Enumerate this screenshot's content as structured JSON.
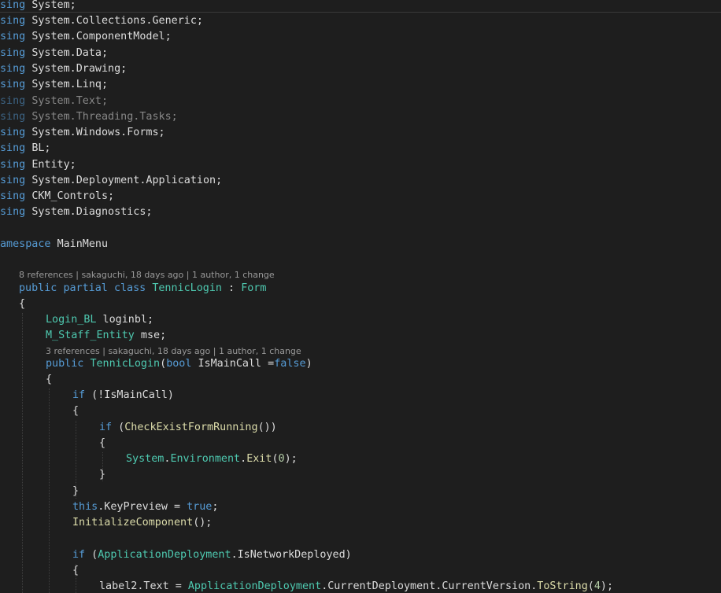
{
  "editor": {
    "usings": [
      {
        "kw": "sing",
        "ns": "System;",
        "dim": false
      },
      {
        "kw": "sing",
        "ns": "System.Collections.Generic;",
        "dim": false
      },
      {
        "kw": "sing",
        "ns": "System.ComponentModel;",
        "dim": false
      },
      {
        "kw": "sing",
        "ns": "System.Data;",
        "dim": false
      },
      {
        "kw": "sing",
        "ns": "System.Drawing;",
        "dim": false
      },
      {
        "kw": "sing",
        "ns": "System.Linq;",
        "dim": false
      },
      {
        "kw": "sing",
        "ns": "System.Text;",
        "dim": true
      },
      {
        "kw": "sing",
        "ns": "System.Threading.Tasks;",
        "dim": true
      },
      {
        "kw": "sing",
        "ns": "System.Windows.Forms;",
        "dim": false
      },
      {
        "kw": "sing",
        "ns": "BL;",
        "dim": false
      },
      {
        "kw": "sing",
        "ns": "Entity;",
        "dim": false
      },
      {
        "kw": "sing",
        "ns": "System.Deployment.Application;",
        "dim": false
      },
      {
        "kw": "sing",
        "ns": "CKM_Controls;",
        "dim": false
      },
      {
        "kw": "sing",
        "ns": "System.Diagnostics;",
        "dim": false
      }
    ],
    "namespace_kw": "amespace",
    "namespace_name": "MainMenu",
    "class_lens": "8 references | sakaguchi, 18 days ago | 1 author, 1 change",
    "ctor_lens": "3 references | sakaguchi, 18 days ago | 1 author, 1 change",
    "code": [
      [
        [
          "kw",
          "public"
        ],
        [
          "pl",
          " "
        ],
        [
          "kw",
          "partial"
        ],
        [
          "pl",
          " "
        ],
        [
          "kw",
          "class"
        ],
        [
          "pl",
          " "
        ],
        [
          "ty",
          "TennicLogin"
        ],
        [
          "pl",
          " : "
        ],
        [
          "ty",
          "Form"
        ]
      ],
      [
        [
          "pl",
          "{"
        ]
      ],
      [
        [
          "ty",
          "Login_BL"
        ],
        [
          "pl",
          " loginbl;"
        ]
      ],
      [
        [
          "ty",
          "M_Staff_Entity"
        ],
        [
          "pl",
          " mse;"
        ]
      ],
      [
        [
          "kw",
          "public"
        ],
        [
          "pl",
          " "
        ],
        [
          "ty",
          "TennicLogin"
        ],
        [
          "pl",
          "("
        ],
        [
          "kw",
          "bool"
        ],
        [
          "pl",
          " IsMainCall ="
        ],
        [
          "kw",
          "false"
        ],
        [
          "pl",
          ")"
        ]
      ],
      [
        [
          "pl",
          "{"
        ]
      ],
      [
        [
          "kw",
          "if"
        ],
        [
          "pl",
          " (!IsMainCall)"
        ]
      ],
      [
        [
          "pl",
          "{"
        ]
      ],
      [
        [
          "kw",
          "if"
        ],
        [
          "pl",
          " ("
        ],
        [
          "mt",
          "CheckExistFormRunning"
        ],
        [
          "pl",
          "())"
        ]
      ],
      [
        [
          "pl",
          "{"
        ]
      ],
      [
        [
          "ty",
          "System"
        ],
        [
          "pl",
          "."
        ],
        [
          "ty",
          "Environment"
        ],
        [
          "pl",
          "."
        ],
        [
          "mt",
          "Exit"
        ],
        [
          "pl",
          "("
        ],
        [
          "nm",
          "0"
        ],
        [
          "pl",
          ");"
        ]
      ],
      [
        [
          "pl",
          "}"
        ]
      ],
      [
        [
          "pl",
          "}"
        ]
      ],
      [
        [
          "kw",
          "this"
        ],
        [
          "pl",
          ".KeyPreview = "
        ],
        [
          "kw",
          "true"
        ],
        [
          "pl",
          ";"
        ]
      ],
      [
        [
          "mt",
          "InitializeComponent"
        ],
        [
          "pl",
          "();"
        ]
      ],
      [
        [
          "kw",
          "if"
        ],
        [
          "pl",
          " ("
        ],
        [
          "ty",
          "ApplicationDeployment"
        ],
        [
          "pl",
          ".IsNetworkDeployed)"
        ]
      ],
      [
        [
          "pl",
          "{"
        ]
      ],
      [
        [
          "pl",
          "label2.Text = "
        ],
        [
          "ty",
          "ApplicationDeployment"
        ],
        [
          "pl",
          ".CurrentDeployment.CurrentVersion."
        ],
        [
          "mt",
          "ToString"
        ],
        [
          "pl",
          "("
        ],
        [
          "nm",
          "4"
        ],
        [
          "pl",
          ");"
        ]
      ]
    ]
  }
}
